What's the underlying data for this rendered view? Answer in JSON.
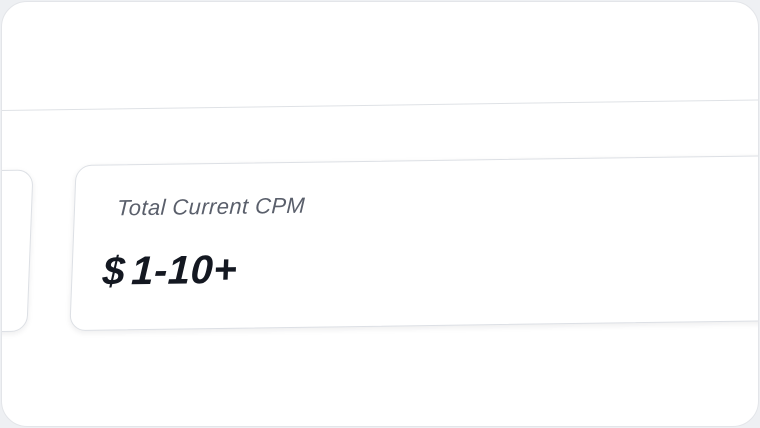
{
  "metric_card": {
    "label": "Total Current CPM",
    "currency_symbol": "$",
    "value": "1-10+"
  },
  "colors": {
    "background": "#ffffff",
    "label_text": "#5a5f6b",
    "value_text": "#141821",
    "border": "#dde0e5"
  }
}
